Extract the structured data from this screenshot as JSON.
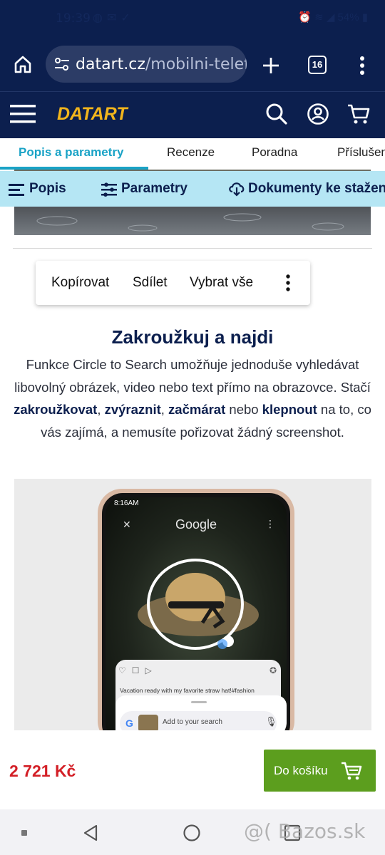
{
  "status": {
    "time": "19:39",
    "left_icons": [
      "globe-icon",
      "mail-icon",
      "check-icon"
    ],
    "right_icons": [
      "alarm-icon",
      "wifi-icon",
      "signal-icon"
    ],
    "battery": "54%"
  },
  "browser": {
    "url_domain": "datart.cz",
    "url_path": "/mobilni-telef",
    "tab_count": "16"
  },
  "header": {
    "logo_text": "DATART"
  },
  "tabs": [
    {
      "label": "Popis a parametry",
      "active": true
    },
    {
      "label": "Recenze"
    },
    {
      "label": "Poradna"
    },
    {
      "label": "Příslušen"
    }
  ],
  "subnav": [
    {
      "label": "Popis",
      "icon": "text-lines-icon"
    },
    {
      "label": "Parametry",
      "icon": "sliders-icon"
    },
    {
      "label": "Dokumenty ke stažen",
      "icon": "cloud-download-icon"
    }
  ],
  "context_menu": {
    "copy": "Kopírovat",
    "share": "Sdílet",
    "select_all": "Vybrat vše"
  },
  "article": {
    "heading": "Zakroužkuj a najdi",
    "p1": "Funkce Circle to Search umožňuje jednoduše vyhledávat libovolný obrázek, video nebo text přímo na obrazovce. Stačí ",
    "b1": "zakroužkovat",
    "p2": ", ",
    "b2": "zvýraznit",
    "p3": ", ",
    "b3": "začmárat",
    "p4": " nebo ",
    "b4": "klepnout",
    "p5": " na to, co vás zajímá, a nemusíte pořizovat žádný screenshot."
  },
  "phone_screenshot": {
    "time": "8:16AM",
    "app_title": "Google",
    "caption": "Vacation ready with my favorite straw hat!#fashion",
    "search_placeholder": "Add to your search"
  },
  "purchase": {
    "price": "2 721 Kč",
    "button_label": "Do košíku"
  },
  "watermark": "@( Bazos.sk",
  "colors": {
    "brand_navy": "#0c1f4e",
    "brand_yellow": "#f2b51c",
    "accent_teal": "#1aa3c6",
    "price_red": "#d31f26",
    "cart_green": "#5c9e1e"
  }
}
